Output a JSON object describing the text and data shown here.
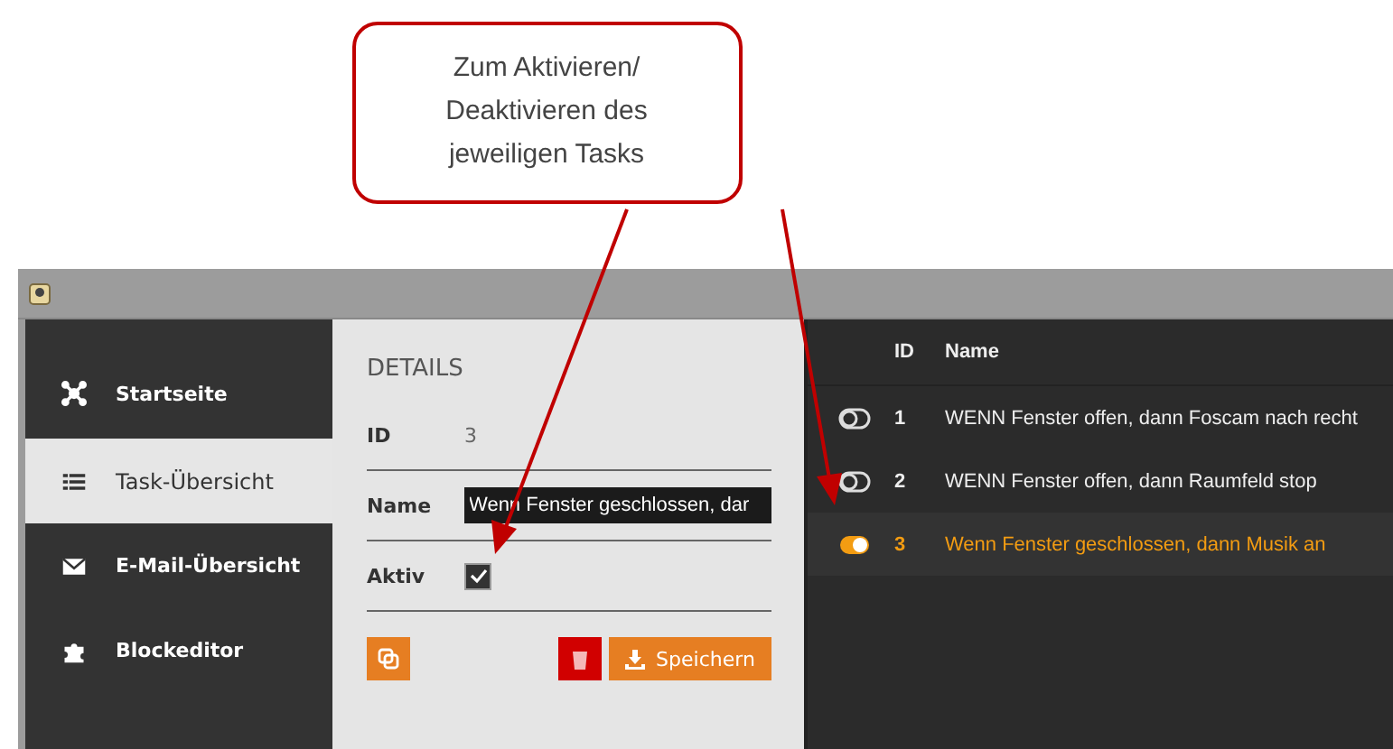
{
  "callout": {
    "lines": [
      "Zum Aktivieren/",
      "Deaktivieren des",
      "jeweiligen Tasks"
    ]
  },
  "sidebar": {
    "items": [
      {
        "label": "Startseite",
        "selected": false
      },
      {
        "label": "Task-Übersicht",
        "selected": true
      },
      {
        "label": "E-Mail-Übersicht",
        "selected": false
      },
      {
        "label": "Blockeditor",
        "selected": false
      }
    ]
  },
  "details": {
    "title": "DETAILS",
    "id_label": "ID",
    "id_value": "3",
    "name_label": "Name",
    "name_value": "Wenn Fenster geschlossen, dar",
    "active_label": "Aktiv",
    "active_checked": true,
    "save_label": "Speichern"
  },
  "table": {
    "columns": [
      "ID",
      "Name"
    ],
    "rows": [
      {
        "id": "1",
        "name": "WENN Fenster offen, dann Foscam nach recht",
        "active": false,
        "selected": false
      },
      {
        "id": "2",
        "name": "WENN Fenster offen, dann Raumfeld stop",
        "active": false,
        "selected": false
      },
      {
        "id": "3",
        "name": "Wenn Fenster geschlossen, dann Musik an",
        "active": true,
        "selected": true
      }
    ]
  }
}
